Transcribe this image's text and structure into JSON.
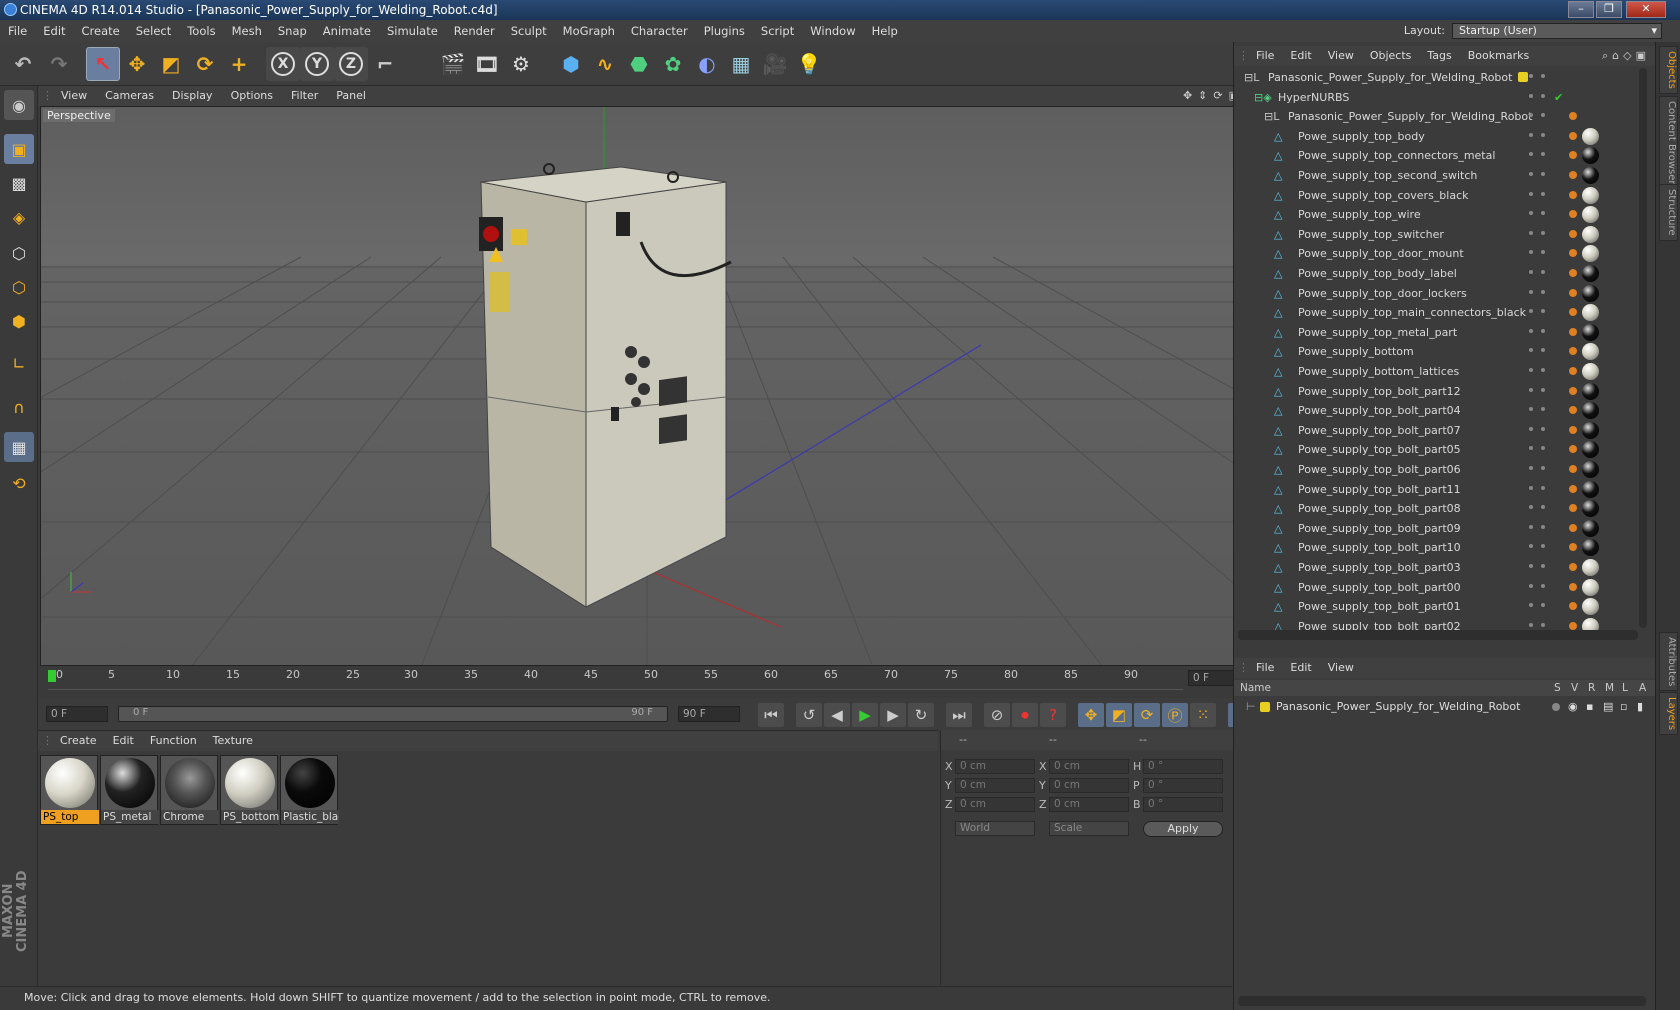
{
  "window": {
    "title": "CINEMA 4D R14.014 Studio - [Panasonic_Power_Supply_for_Welding_Robot.c4d]",
    "controls": [
      "–",
      "❐",
      "✕"
    ]
  },
  "menubar": {
    "items": [
      "File",
      "Edit",
      "Create",
      "Select",
      "Tools",
      "Mesh",
      "Snap",
      "Animate",
      "Simulate",
      "Render",
      "Sculpt",
      "MoGraph",
      "Character",
      "Plugins",
      "Script",
      "Window",
      "Help"
    ],
    "layout_label": "Layout:",
    "layout_value": "Startup (User)"
  },
  "toolbar": {
    "icons": [
      "undo-icon",
      "redo-icon",
      "live-selection-icon",
      "move-icon",
      "scale-icon",
      "rotate-icon",
      "add-icon",
      "x-axis-icon",
      "y-axis-icon",
      "z-axis-icon",
      "coordinate-system-icon",
      "render-view-icon",
      "render-picture-viewer-icon",
      "render-settings-icon",
      "cube-icon",
      "spline-icon",
      "nurbs-icon",
      "array-icon",
      "deformer-icon",
      "floor-icon",
      "camera-icon",
      "light-icon"
    ],
    "axis_labels": [
      "X",
      "Y",
      "Z"
    ]
  },
  "viewport": {
    "menu": [
      "View",
      "Cameras",
      "Display",
      "Options",
      "Filter",
      "Panel"
    ],
    "label": "Perspective"
  },
  "timeline": {
    "ticks": [
      "0",
      "5",
      "10",
      "15",
      "20",
      "25",
      "30",
      "35",
      "40",
      "45",
      "50",
      "55",
      "60",
      "65",
      "70",
      "75",
      "80",
      "85",
      "90"
    ],
    "current_frame": "0 F"
  },
  "transport": {
    "start_field": "0 F",
    "range_start": "0 F",
    "range_end": "90 F",
    "end_field": "90 F"
  },
  "materials": {
    "menu": [
      "Create",
      "Edit",
      "Function",
      "Texture"
    ],
    "items": [
      {
        "name": "PS_top",
        "color": "#d8d6c8"
      },
      {
        "name": "PS_metal",
        "color": "#222222"
      },
      {
        "name": "Chrome",
        "color": "#555555"
      },
      {
        "name": "PS_bottom",
        "color": "#d0ceC0"
      },
      {
        "name": "Plastic_blac",
        "color": "#0a0a0a"
      }
    ]
  },
  "coordinates": {
    "headers": [
      "--",
      "--",
      "--"
    ],
    "rows": [
      {
        "a": "X",
        "av": "0 cm",
        "b": "X",
        "bv": "0 cm",
        "c": "H",
        "cv": "0 °"
      },
      {
        "a": "Y",
        "av": "0 cm",
        "b": "Y",
        "bv": "0 cm",
        "c": "P",
        "cv": "0 °"
      },
      {
        "a": "Z",
        "av": "0 cm",
        "b": "Z",
        "bv": "0 cm",
        "c": "B",
        "cv": "0 °"
      }
    ],
    "mode": "World",
    "type": "Scale",
    "apply": "Apply"
  },
  "objects": {
    "menu": [
      "File",
      "Edit",
      "View",
      "Objects",
      "Tags",
      "Bookmarks"
    ],
    "tree": [
      {
        "name": "Panasonic_Power_Supply_for_Welding_Robot",
        "level": 0,
        "kind": "null"
      },
      {
        "name": "HyperNURBS",
        "level": 1,
        "kind": "nurbs"
      },
      {
        "name": "Panasonic_Power_Supply_for_Welding_Robot",
        "level": 2,
        "kind": "null"
      },
      {
        "name": "Powe_supply_top_body",
        "level": 3,
        "kind": "poly",
        "tag": "light"
      },
      {
        "name": "Powe_supply_top_connectors_metal",
        "level": 3,
        "kind": "poly",
        "tag": "dark"
      },
      {
        "name": "Powe_supply_top_second_switch",
        "level": 3,
        "kind": "poly",
        "tag": "dark"
      },
      {
        "name": "Powe_supply_top_covers_black",
        "level": 3,
        "kind": "poly",
        "tag": "light"
      },
      {
        "name": "Powe_supply_top_wire",
        "level": 3,
        "kind": "poly",
        "tag": "light"
      },
      {
        "name": "Powe_supply_top_switcher",
        "level": 3,
        "kind": "poly",
        "tag": "light"
      },
      {
        "name": "Powe_supply_top_door_mount",
        "level": 3,
        "kind": "poly",
        "tag": "light"
      },
      {
        "name": "Powe_supply_top_body_label",
        "level": 3,
        "kind": "poly",
        "tag": "dark"
      },
      {
        "name": "Powe_supply_top_door_lockers",
        "level": 3,
        "kind": "poly",
        "tag": "dark"
      },
      {
        "name": "Powe_supply_top_main_connectors_black",
        "level": 3,
        "kind": "poly",
        "tag": "light"
      },
      {
        "name": "Powe_supply_top_metal_part",
        "level": 3,
        "kind": "poly",
        "tag": "dark"
      },
      {
        "name": "Powe_supply_bottom",
        "level": 3,
        "kind": "poly",
        "tag": "light"
      },
      {
        "name": "Powe_supply_bottom_lattices",
        "level": 3,
        "kind": "poly",
        "tag": "light"
      },
      {
        "name": "Powe_supply_top_bolt_part12",
        "level": 3,
        "kind": "poly",
        "tag": "dark"
      },
      {
        "name": "Powe_supply_top_bolt_part04",
        "level": 3,
        "kind": "poly",
        "tag": "dark"
      },
      {
        "name": "Powe_supply_top_bolt_part07",
        "level": 3,
        "kind": "poly",
        "tag": "dark"
      },
      {
        "name": "Powe_supply_top_bolt_part05",
        "level": 3,
        "kind": "poly",
        "tag": "dark"
      },
      {
        "name": "Powe_supply_top_bolt_part06",
        "level": 3,
        "kind": "poly",
        "tag": "dark"
      },
      {
        "name": "Powe_supply_top_bolt_part11",
        "level": 3,
        "kind": "poly",
        "tag": "dark"
      },
      {
        "name": "Powe_supply_top_bolt_part08",
        "level": 3,
        "kind": "poly",
        "tag": "dark"
      },
      {
        "name": "Powe_supply_top_bolt_part09",
        "level": 3,
        "kind": "poly",
        "tag": "dark"
      },
      {
        "name": "Powe_supply_top_bolt_part10",
        "level": 3,
        "kind": "poly",
        "tag": "dark"
      },
      {
        "name": "Powe_supply_top_bolt_part03",
        "level": 3,
        "kind": "poly",
        "tag": "light"
      },
      {
        "name": "Powe_supply_top_bolt_part00",
        "level": 3,
        "kind": "poly",
        "tag": "light"
      },
      {
        "name": "Powe_supply_top_bolt_part01",
        "level": 3,
        "kind": "poly",
        "tag": "light"
      },
      {
        "name": "Powe_supply_top_bolt_part02",
        "level": 3,
        "kind": "poly",
        "tag": "light"
      }
    ]
  },
  "layers": {
    "menu": [
      "File",
      "Edit",
      "View"
    ],
    "header": {
      "name": "Name",
      "cols": [
        "S",
        "V",
        "R",
        "M",
        "L",
        "A"
      ]
    },
    "items": [
      {
        "name": "Panasonic_Power_Supply_for_Welding_Robot"
      }
    ]
  },
  "side_tabs": [
    "Objects",
    "Content Browser",
    "Structure",
    "Attributes",
    "Layers"
  ],
  "branding": "MAXON CINEMA 4D",
  "status": "Move: Click and drag to move elements. Hold down SHIFT to quantize movement / add to the selection in point mode, CTRL to remove."
}
